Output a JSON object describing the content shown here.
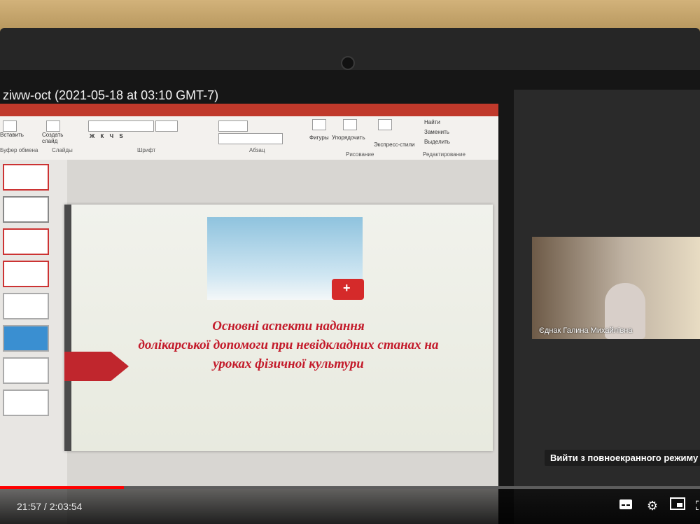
{
  "video": {
    "title": "ziww-oct (2021-05-18 at 03:10 GMT-7)",
    "current_time": "21:57",
    "duration": "2:03:54",
    "time_separator": " / ",
    "progress": 0.177
  },
  "ribbon": {
    "clipboard_label": "Буфер обмена",
    "paste_label": "Вставить",
    "new_slide_label": "Создать слайд",
    "slides_label": "Слайды",
    "font_label": "Шрифт",
    "paragraph_label": "Абзац",
    "shapes_label": "Фигуры",
    "arrange_label": "Упорядочить",
    "quick_styles_label": "Экспресс-стили",
    "drawing_label": "Рисование",
    "find_label": "Найти",
    "replace_label": "Заменить",
    "select_label": "Выделить",
    "editing_label": "Редактирование"
  },
  "slide": {
    "title_line1": "Основні аспекти надання",
    "title_line2": "долікарської допомоги при невідкладних станах на",
    "title_line3": "уроках фізичної культури"
  },
  "participant": {
    "name": "Єднак Галина Михайлівна"
  },
  "tooltip": {
    "exit_fullscreen": "Вийти з повноекранного режиму (f)"
  },
  "icons": [
    "subtitles-icon",
    "settings-gear-icon",
    "miniplayer-icon",
    "fullscreen-exit-icon"
  ]
}
